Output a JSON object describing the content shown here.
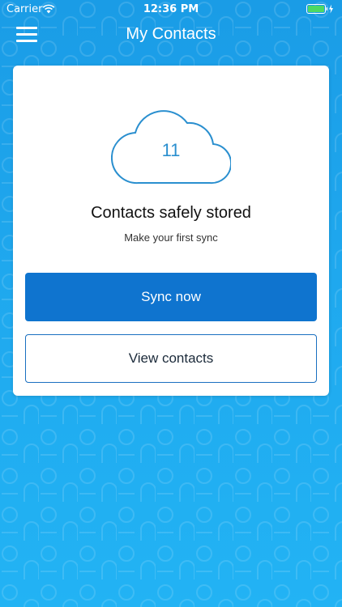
{
  "status_bar": {
    "carrier": "Carrier",
    "time": "12:36 PM",
    "wifi_icon": "wifi-icon",
    "battery_icon": "battery-charging-icon",
    "battery_color": "#4cd964"
  },
  "nav": {
    "title": "My Contacts",
    "menu_icon": "hamburger-menu-icon"
  },
  "card": {
    "cloud_icon": "cloud-icon",
    "contact_count": "11",
    "title": "Contacts safely stored",
    "subtitle": "Make your first sync",
    "primary_button_label": "Sync now",
    "secondary_button_label": "View contacts"
  },
  "colors": {
    "background_top": "#1a9ce6",
    "background_bottom": "#22b3f4",
    "primary_button": "#0f74cf",
    "cloud_stroke": "#2a8fcf"
  }
}
